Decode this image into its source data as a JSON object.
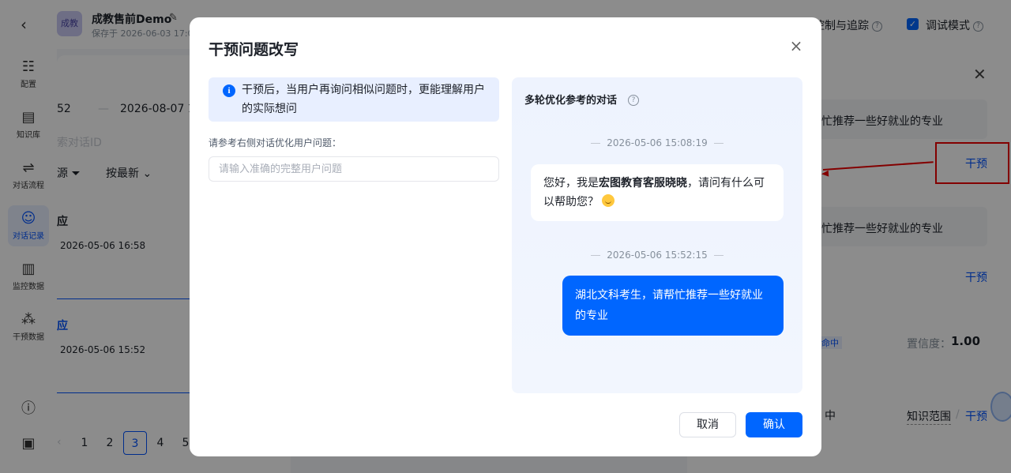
{
  "header": {
    "back_icon": "arrow-left-icon",
    "app_logo": "成教",
    "app_name": "成教售前Demo",
    "save_time": "保存于 2026-06-03 17:0",
    "trace_label": "控制与追踪",
    "debug_label": "调试模式",
    "debug_checked": true
  },
  "sidenav": {
    "items": [
      {
        "label": "配置",
        "icon": "sliders-icon"
      },
      {
        "label": "知识库",
        "icon": "book-icon"
      },
      {
        "label": "对话流程",
        "icon": "flow-icon"
      },
      {
        "label": "对话记录",
        "icon": "chat-icon",
        "active": true
      },
      {
        "label": "监控数据",
        "icon": "chart-icon"
      },
      {
        "label": "干预数据",
        "icon": "intervene-icon"
      }
    ],
    "bottom": [
      "help-icon",
      "document-icon"
    ]
  },
  "list": {
    "date_start": "52",
    "date_sep": "—",
    "date_end": "2026-08-07 1",
    "search_placeholder": "索对话ID",
    "filter_label": "源",
    "sort_label": "按最新",
    "rows": [
      {
        "title": "应",
        "time": "2026-05-06 16:58"
      },
      {
        "title": "应",
        "time": "2026-05-06 15:52"
      }
    ],
    "pages": [
      "1",
      "2",
      "3",
      "4",
      "5"
    ],
    "current_page": "3"
  },
  "right": {
    "q1": "忙推荐一些好就业的专业",
    "intervene1": "干预",
    "q2": "忙推荐一些好就业的专业",
    "intervene2": "干预",
    "hit_badge": "命中",
    "confidence_label": "置信度：",
    "confidence_value": "1.00",
    "hit_label": "中",
    "scope_label": "知识范围",
    "sep": "/",
    "intervene3": "干预"
  },
  "modal": {
    "title": "干预问题改写",
    "info_text": "干预后，当用户再询问相似问题时，更能理解用户的实际想问",
    "field_label": "请参考右侧对话优化用户问题：",
    "input_placeholder": "请输入准确的完整用户问题",
    "input_value": "",
    "conversation_title": "多轮优化参考的对话",
    "messages": [
      {
        "time": "2026-05-06 15:08:19",
        "role": "bot",
        "text_pre": "您好，我是",
        "text_bold": "宏图教育客服晓晓",
        "text_post": "，请问有什么可以帮助您？"
      },
      {
        "time": "2026-05-06 15:52:15",
        "role": "user",
        "text": "湖北文科考生，请帮忙推荐一些好就业的专业"
      }
    ],
    "cancel_label": "取消",
    "confirm_label": "确认"
  }
}
